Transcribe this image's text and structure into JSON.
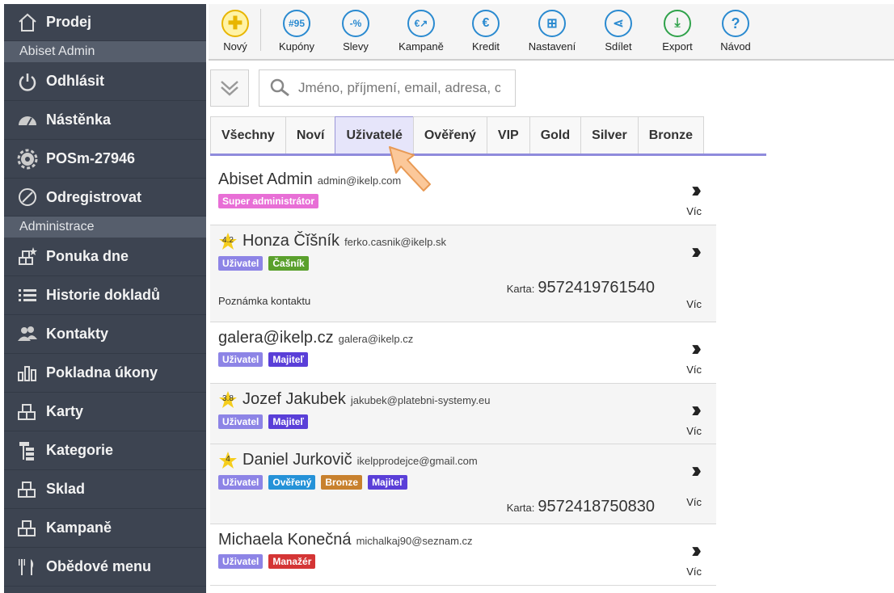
{
  "sidebar": {
    "items": [
      {
        "label": "Prodej",
        "icon": "home-icon"
      },
      {
        "section": "Abiset Admin"
      },
      {
        "label": "Odhlásit",
        "icon": "power-icon"
      },
      {
        "label": "Nástěnka",
        "icon": "dashboard-icon"
      },
      {
        "label": "POSm-27946",
        "icon": "gear-icon"
      },
      {
        "label": "Odregistrovat",
        "icon": "ban-icon"
      },
      {
        "section": "Administrace"
      },
      {
        "label": "Ponuka dne",
        "icon": "star-boxes-icon"
      },
      {
        "label": "Historie dokladů",
        "icon": "list-icon"
      },
      {
        "label": "Kontakty",
        "icon": "users-icon"
      },
      {
        "label": "Pokladna úkony",
        "icon": "bars-icon"
      },
      {
        "label": "Karty",
        "icon": "boxes-icon"
      },
      {
        "label": "Kategorie",
        "icon": "tree-icon"
      },
      {
        "label": "Sklad",
        "icon": "boxes-icon"
      },
      {
        "label": "Kampaně",
        "icon": "boxes-icon"
      },
      {
        "label": "Obědové menu",
        "icon": "cutlery-icon"
      }
    ]
  },
  "toolbar": {
    "new_label": "Nový",
    "buttons": [
      {
        "label": "Kupóny",
        "glyph": "#95"
      },
      {
        "label": "Slevy",
        "glyph": "-%"
      },
      {
        "label": "Kampaně",
        "glyph": "€↗"
      },
      {
        "label": "Kredit",
        "glyph": "€"
      },
      {
        "label": "Nastavení",
        "glyph": "⊞"
      },
      {
        "label": "Sdílet",
        "glyph": "⋖"
      },
      {
        "label": "Export",
        "glyph": "⤓"
      },
      {
        "label": "Návod",
        "glyph": "?"
      }
    ]
  },
  "search": {
    "placeholder": "Jméno, příjmení, email, adresa, c"
  },
  "tabs": [
    "Všechny",
    "Noví",
    "Uživatelé",
    "Ověřený",
    "VIP",
    "Gold",
    "Silver",
    "Bronze"
  ],
  "active_tab": "Uživatelé",
  "contacts": [
    {
      "name": "Abiset Admin",
      "email": "admin@ikelp.com",
      "badges": [
        {
          "t": "Super administrátor",
          "c": "#e86fd6"
        }
      ],
      "more": "Víc"
    },
    {
      "rating": "4.2",
      "name": "Honza Čĭšník",
      "email": "ferko.casnik@ikelp.sk",
      "badges": [
        {
          "t": "Uživatel",
          "c": "#8d84e6"
        },
        {
          "t": "Čašník",
          "c": "#5aa02c"
        }
      ],
      "card_label": "Karta:",
      "card": "9572419761540",
      "note": "Poznámka kontaktu",
      "more": "Víc"
    },
    {
      "name": "galera@ikelp.cz",
      "email": "galera@ikelp.cz",
      "badges": [
        {
          "t": "Uživatel",
          "c": "#8d84e6"
        },
        {
          "t": "Majiteľ",
          "c": "#5a3fd8"
        }
      ],
      "more": "Víc"
    },
    {
      "rating": "3.8",
      "name": "Jozef Jakubek",
      "email": "jakubek@platebni-systemy.eu",
      "badges": [
        {
          "t": "Uživatel",
          "c": "#8d84e6"
        },
        {
          "t": "Majiteľ",
          "c": "#5a3fd8"
        }
      ],
      "more": "Víc"
    },
    {
      "rating": "4",
      "name": "Daniel Jurkovič",
      "email": "ikelpprodejce@gmail.com",
      "badges": [
        {
          "t": "Uživatel",
          "c": "#8d84e6"
        },
        {
          "t": "Ověřený",
          "c": "#2592d8"
        },
        {
          "t": "Bronze",
          "c": "#c8812e"
        },
        {
          "t": "Majiteľ",
          "c": "#5a3fd8"
        }
      ],
      "card_label": "Karta:",
      "card": "9572418750830",
      "more": "Víc"
    },
    {
      "name": "Michaela Konečná",
      "email": "michalkaj90@seznam.cz",
      "badges": [
        {
          "t": "Uživatel",
          "c": "#8d84e6"
        },
        {
          "t": "Manažér",
          "c": "#d43535"
        }
      ],
      "more": "Víc"
    }
  ]
}
